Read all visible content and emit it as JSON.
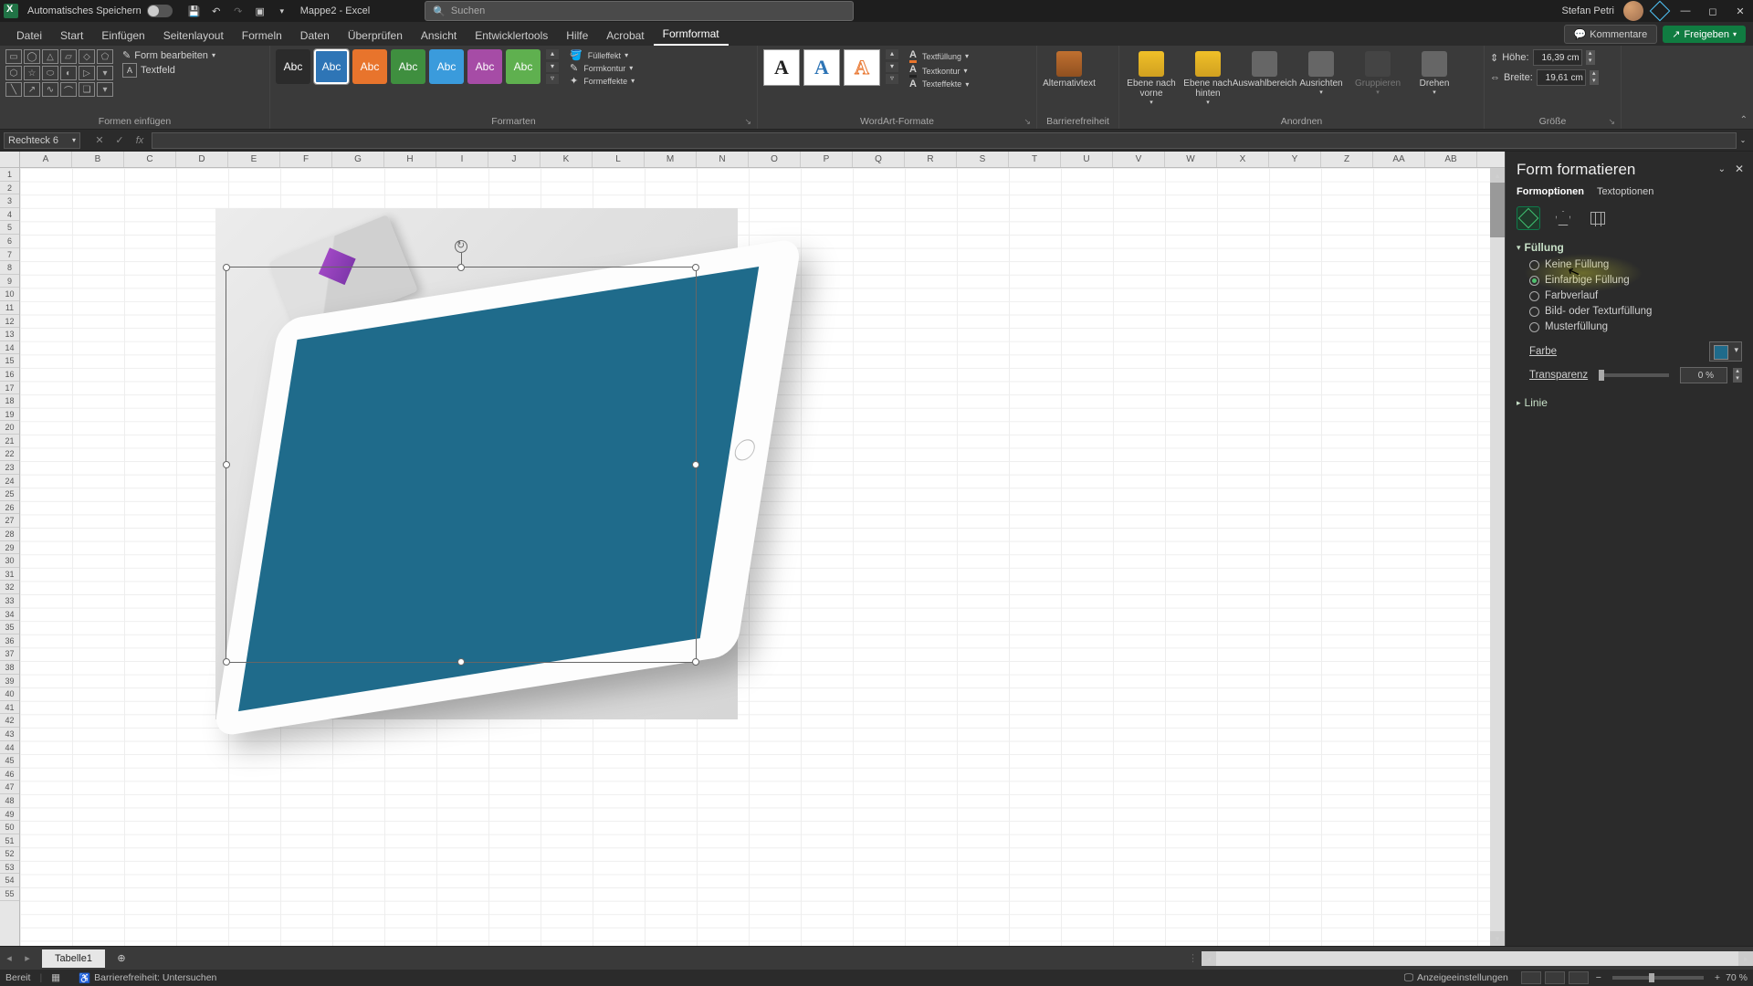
{
  "titlebar": {
    "autosave": "Automatisches Speichern",
    "filename": "Mappe2 - Excel",
    "search_placeholder": "Suchen",
    "username": "Stefan Petri"
  },
  "tabs": {
    "items": [
      "Datei",
      "Start",
      "Einfügen",
      "Seitenlayout",
      "Formeln",
      "Daten",
      "Überprüfen",
      "Ansicht",
      "Entwicklertools",
      "Hilfe",
      "Acrobat",
      "Formformat"
    ],
    "active_index": 11,
    "comments": "Kommentare",
    "share": "Freigeben"
  },
  "ribbon": {
    "insert_shapes": {
      "label": "Formen einfügen",
      "edit_shape": "Form bearbeiten",
      "textfield": "Textfeld"
    },
    "shape_styles": {
      "label": "Formarten",
      "swatch_text": "Abc",
      "colors": [
        "#2b2b2b",
        "#2e75b6",
        "#e8742c",
        "#3f8f3f",
        "#3a9bdc",
        "#a64ca6",
        "#5fb04f"
      ],
      "fill": "Fülleffekt",
      "outline": "Formkontur",
      "effects": "Formeffekte"
    },
    "wordart": {
      "label": "WordArt-Formate",
      "textfill": "Textfüllung",
      "textoutline": "Textkontur",
      "texteffects": "Texteffekte"
    },
    "accessibility": {
      "label": "Barrierefreiheit",
      "alt": "Alternativtext"
    },
    "arrange": {
      "label": "Anordnen",
      "forward": "Ebene nach vorne",
      "backward": "Ebene nach hinten",
      "selection": "Auswahlbereich",
      "align": "Ausrichten",
      "group": "Gruppieren",
      "rotate": "Drehen"
    },
    "size": {
      "label": "Größe",
      "height_lbl": "Höhe:",
      "height": "16,39 cm",
      "width_lbl": "Breite:",
      "width": "19,61 cm"
    }
  },
  "namebox": "Rechteck 6",
  "cols": [
    "A",
    "B",
    "C",
    "D",
    "E",
    "F",
    "G",
    "H",
    "I",
    "J",
    "K",
    "L",
    "M",
    "N",
    "O",
    "P",
    "Q",
    "R",
    "S",
    "T",
    "U",
    "V",
    "W",
    "X",
    "Y",
    "Z",
    "AA",
    "AB"
  ],
  "fpane": {
    "title": "Form formatieren",
    "tab_shape": "Formoptionen",
    "tab_text": "Textoptionen",
    "section_fill": "Füllung",
    "opts": {
      "none": "Keine Füllung",
      "solid": "Einfarbige Füllung",
      "gradient": "Farbverlauf",
      "picture": "Bild- oder Texturfüllung",
      "pattern": "Musterfüllung"
    },
    "color_lbl": "Farbe",
    "trans_lbl": "Transparenz",
    "trans_val": "0 %",
    "section_line": "Linie"
  },
  "sheettabs": {
    "active": "Tabelle1"
  },
  "status": {
    "ready": "Bereit",
    "a11y": "Barrierefreiheit: Untersuchen",
    "display": "Anzeigeeinstellungen",
    "zoom": "70 %"
  }
}
